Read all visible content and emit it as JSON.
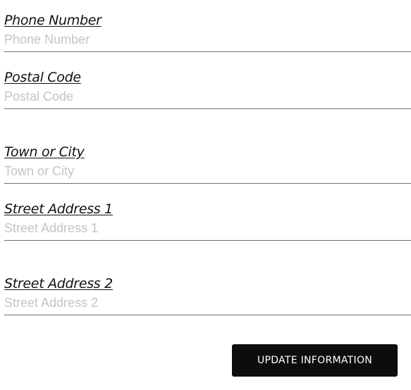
{
  "form": {
    "fields": [
      {
        "label": "Phone Number",
        "placeholder": "Phone Number",
        "value": ""
      },
      {
        "label": "Postal Code",
        "placeholder": "Postal Code",
        "value": ""
      },
      {
        "label": "Town or City",
        "placeholder": "Town or City",
        "value": ""
      },
      {
        "label": "Street Address 1",
        "placeholder": "Street Address 1",
        "value": ""
      },
      {
        "label": "Street Address 2",
        "placeholder": "Street Address 2",
        "value": ""
      }
    ],
    "submit_label": "UPDATE INFORMATION"
  },
  "colors": {
    "button_bg": "#0c0d0f",
    "button_text": "#ffffff",
    "placeholder": "#c4c4c4",
    "divider": "#6f6f6f"
  }
}
